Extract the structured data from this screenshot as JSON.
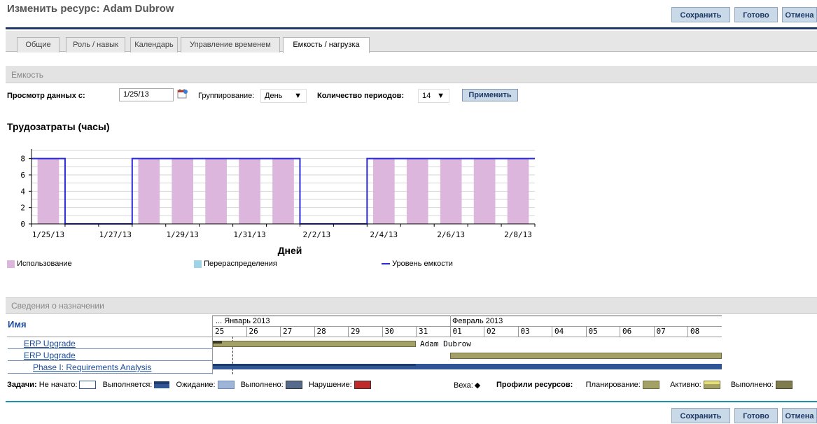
{
  "page": {
    "title": "Изменить ресурс: Adam Dubrow"
  },
  "buttons": {
    "save": "Сохранить",
    "done": "Готово",
    "cancel": "Отмена"
  },
  "tabs": [
    {
      "label": "Общие",
      "active": false
    },
    {
      "label": "Роль / навык",
      "active": false
    },
    {
      "label": "Календарь",
      "active": false
    },
    {
      "label": "Управление временем",
      "active": false
    },
    {
      "label": "Емкость / нагрузка",
      "active": true
    }
  ],
  "capacity": {
    "section_title": "Емкость",
    "view_from_label": "Просмотр данных с:",
    "view_from_value": "1/25/13",
    "grouping_label": "Группирование:",
    "grouping_value": "День",
    "periods_label": "Количество периодов:",
    "periods_value": "14",
    "apply_label": "Применить"
  },
  "chart_data": {
    "type": "bar",
    "title": "Трудозатраты (часы)",
    "xlabel": "Дней",
    "ylabel": "",
    "ylim": [
      0,
      9
    ],
    "y_ticks": [
      0,
      2,
      4,
      6,
      8
    ],
    "categories": [
      "1/25/13",
      "1/26/13",
      "1/27/13",
      "1/28/13",
      "1/29/13",
      "1/30/13",
      "1/31/13",
      "2/1/13",
      "2/2/13",
      "2/3/13",
      "2/4/13",
      "2/5/13",
      "2/6/13",
      "2/7/13",
      "2/8/13"
    ],
    "x_tick_labels": [
      "1/25/13",
      "1/27/13",
      "1/29/13",
      "1/31/13",
      "2/2/13",
      "2/4/13",
      "2/6/13",
      "2/8/13"
    ],
    "series": [
      {
        "name": "Использование",
        "type": "bar",
        "color": "#dcb6dd",
        "values": [
          8,
          0,
          0,
          8,
          8,
          8,
          8,
          8,
          0,
          0,
          8,
          8,
          8,
          8,
          8
        ]
      },
      {
        "name": "Перераспределения",
        "type": "bar",
        "color": "#9fd3e6",
        "values": [
          0,
          0,
          0,
          0,
          0,
          0,
          0,
          0,
          0,
          0,
          0,
          0,
          0,
          0,
          0
        ]
      },
      {
        "name": "Уровень емкости",
        "type": "step",
        "color": "#2b2bd6",
        "values": [
          8,
          0,
          0,
          8,
          8,
          8,
          8,
          8,
          0,
          0,
          8,
          8,
          8,
          8,
          8
        ]
      }
    ],
    "grid": true,
    "legend": "bottom"
  },
  "assignments": {
    "section_title": "Сведения о назначении",
    "name_header": "Имя",
    "month_jan": "... Январь 2013",
    "month_feb": "Февраль 2013",
    "days": [
      "25",
      "26",
      "27",
      "28",
      "29",
      "30",
      "31",
      "01",
      "02",
      "03",
      "04",
      "05",
      "06",
      "07",
      "08"
    ],
    "rows": [
      {
        "name": "ERP Upgrade",
        "bar_label": "Adam Dubrow"
      },
      {
        "name": "ERP Upgrade",
        "bar_label": ""
      },
      {
        "name": "Phase I: Requirements Analysis",
        "bar_label": ""
      }
    ]
  },
  "key": {
    "tasks_label": "Задачи:",
    "not_started": "Не начато:",
    "in_progress": "Выполняется:",
    "waiting": "Ожидание:",
    "completed": "Выполнено:",
    "violation": "Нарушение:",
    "milestone": "Веха:",
    "profiles_label": "Профили ресурсов:",
    "planning": "Планирование:",
    "active": "Активно:",
    "done": "Выполнено:"
  },
  "colors": {
    "accent": "#1f3a68",
    "capacity_line": "#2b2bd6",
    "usage": "#dcb6dd",
    "gantt_bar": "#a3a166",
    "task_bar": "#2f5597"
  }
}
